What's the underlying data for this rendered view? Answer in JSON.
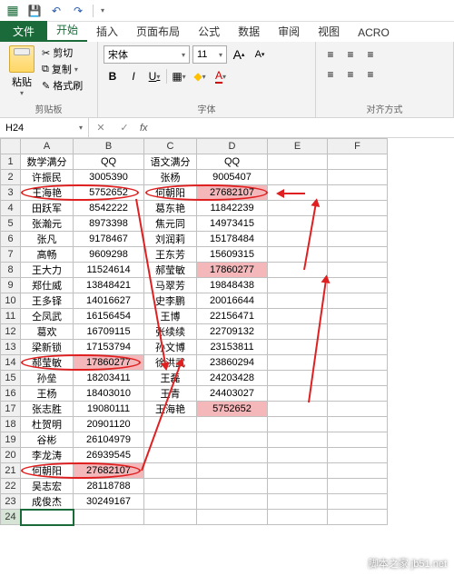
{
  "qat": {
    "save": "💾",
    "undo": "↶",
    "redo": "↷"
  },
  "tabs": {
    "file": "文件",
    "items": [
      "开始",
      "插入",
      "页面布局",
      "公式",
      "数据",
      "审阅",
      "视图",
      "ACRO"
    ],
    "active": 0
  },
  "ribbon": {
    "clipboard": {
      "paste": "粘贴",
      "cut": "剪切",
      "copy": "复制",
      "brush": "格式刷",
      "label": "剪贴板",
      "cut_icon": "✂",
      "copy_icon": "⧉",
      "brush_icon": "✎"
    },
    "font": {
      "name": "宋体",
      "size": "11",
      "inc_a": "A",
      "dec_a": "A",
      "bold": "B",
      "italic": "I",
      "underline": "U",
      "border_icon": "▦",
      "fill_icon": "◆",
      "color_icon": "A",
      "label": "字体"
    },
    "align": {
      "label": "对齐方式"
    }
  },
  "namebox": {
    "ref": "H24",
    "fx": "fx"
  },
  "columns": [
    "A",
    "B",
    "C",
    "D",
    "E",
    "F"
  ],
  "headers": {
    "A": "数学满分",
    "B": "QQ",
    "C": "语文满分",
    "D": "QQ"
  },
  "rows": [
    {
      "n": 1,
      "A": "数学满分",
      "B": "QQ",
      "C": "语文满分",
      "D": "QQ",
      "hdr": true
    },
    {
      "n": 2,
      "A": "许振民",
      "B": "3005390",
      "C": "张杨",
      "D": "9005407"
    },
    {
      "n": 3,
      "A": "王海艳",
      "B": "5752652",
      "C": "何朝阳",
      "D": "27682107",
      "pinkD": true
    },
    {
      "n": 4,
      "A": "田跃军",
      "B": "8542222",
      "C": "葛东艳",
      "D": "11842239"
    },
    {
      "n": 5,
      "A": "张瀚元",
      "B": "8973398",
      "C": "焦元同",
      "D": "14973415"
    },
    {
      "n": 6,
      "A": "张凡",
      "B": "9178467",
      "C": "刘润莉",
      "D": "15178484"
    },
    {
      "n": 7,
      "A": "高畅",
      "B": "9609298",
      "C": "王东芳",
      "D": "15609315"
    },
    {
      "n": 8,
      "A": "王大力",
      "B": "11524614",
      "C": "郝莹敏",
      "D": "17860277",
      "pinkD": true
    },
    {
      "n": 9,
      "A": "郑仕威",
      "B": "13848421",
      "C": "马翠芳",
      "D": "19848438"
    },
    {
      "n": 10,
      "A": "王多铎",
      "B": "14016627",
      "C": "史李鹏",
      "D": "20016644"
    },
    {
      "n": 11,
      "A": "仝凤武",
      "B": "16156454",
      "C": "王博",
      "D": "22156471"
    },
    {
      "n": 12,
      "A": "葛欢",
      "B": "16709115",
      "C": "张续续",
      "D": "22709132"
    },
    {
      "n": 13,
      "A": "梁新锁",
      "B": "17153794",
      "C": "孙文博",
      "D": "23153811"
    },
    {
      "n": 14,
      "A": "郝莹敏",
      "B": "17860277",
      "C": "徐洪武",
      "D": "23860294",
      "pinkB": true
    },
    {
      "n": 15,
      "A": "孙垒",
      "B": "18203411",
      "C": "王磊",
      "D": "24203428"
    },
    {
      "n": 16,
      "A": "王杨",
      "B": "18403010",
      "C": "王青",
      "D": "24403027"
    },
    {
      "n": 17,
      "A": "张志胜",
      "B": "19080111",
      "C": "王海艳",
      "D": "5752652",
      "pinkD": true
    },
    {
      "n": 18,
      "A": "杜贺明",
      "B": "20901120"
    },
    {
      "n": 19,
      "A": "谷彬",
      "B": "26104979"
    },
    {
      "n": 20,
      "A": "李龙涛",
      "B": "26939545"
    },
    {
      "n": 21,
      "A": "何朝阳",
      "B": "27682107",
      "pinkB": true
    },
    {
      "n": 22,
      "A": "吴志宏",
      "B": "28118788"
    },
    {
      "n": 23,
      "A": "成俊杰",
      "B": "30249167"
    },
    {
      "n": 24,
      "sel": true
    }
  ],
  "watermark": "脚本之家 jb51.net"
}
